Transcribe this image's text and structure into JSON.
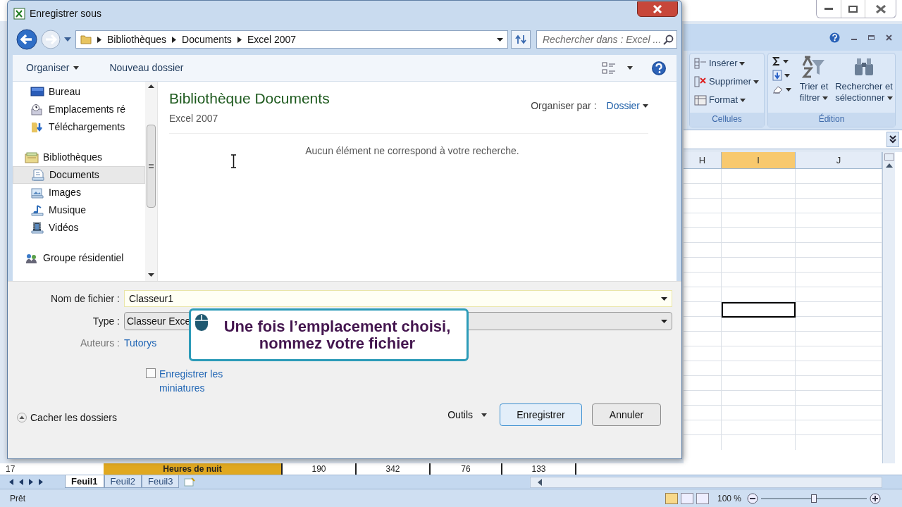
{
  "dialog": {
    "title": "Enregistrer sous",
    "breadcrumb": [
      "Bibliothèques",
      "Documents",
      "Excel 2007"
    ],
    "search": {
      "placeholder": "Rechercher dans : Excel ..."
    },
    "toolbar": [
      "Organiser",
      "Nouveau dossier"
    ],
    "nav_items": [
      {
        "kind": "item",
        "label": "Bureau",
        "selected": false
      },
      {
        "kind": "item",
        "label": "Emplacements ré",
        "selected": false
      },
      {
        "kind": "item",
        "label": "Téléchargements",
        "selected": false
      },
      {
        "kind": "group",
        "label": "Bibliothèques",
        "selected": false
      },
      {
        "kind": "item",
        "label": "Documents",
        "selected": true
      },
      {
        "kind": "item",
        "label": "Images",
        "selected": false
      },
      {
        "kind": "item",
        "label": "Musique",
        "selected": false
      },
      {
        "kind": "item",
        "label": "Vidéos",
        "selected": false
      },
      {
        "kind": "group",
        "label": "Groupe résidentiel",
        "selected": false
      }
    ],
    "library": {
      "title": "Bibliothèque Documents",
      "subtitle": "Excel 2007",
      "arrange_label": "Organiser par :",
      "arrange_value": "Dossier"
    },
    "empty_message": "Aucun élément ne correspond à votre recherche.",
    "fields": {
      "filename_label": "Nom de fichier :",
      "filename": "Classeur1",
      "type_label": "Type :",
      "type": "Classeur Exce",
      "authors_label": "Auteurs :",
      "authors": "Tutorys"
    },
    "thumbnail_checkbox": {
      "label": "Enregistrer les miniatures",
      "checked": false
    },
    "hide_folders": "Cacher les dossiers",
    "tools": "Outils",
    "buttons": [
      "Enregistrer",
      "Annuler"
    ]
  },
  "callout": {
    "text": "Une fois l’emplacement choisi, nommez votre fichier"
  },
  "excel": {
    "ribbon_groups": [
      {
        "label": "Cellules",
        "items": [
          "Insérer",
          "Supprimer",
          "Format"
        ]
      },
      {
        "label": "Édition",
        "items": [
          "Trier et filtrer",
          "Rechercher et sélectionner"
        ]
      }
    ],
    "columns": [
      {
        "label": "H",
        "selected": false
      },
      {
        "label": "I",
        "selected": true
      },
      {
        "label": "J",
        "selected": false
      }
    ],
    "row": {
      "number": "17",
      "cells": [
        "Heures de nuit",
        "190",
        "342",
        "76",
        "133"
      ]
    },
    "sheet_tabs": [
      {
        "label": "Feuil1",
        "selected": true
      },
      {
        "label": "Feuil2",
        "selected": false
      },
      {
        "label": "Feuil3",
        "selected": false
      }
    ],
    "status": "Prêt",
    "zoom": "100 %",
    "zoom_slider": {
      "level": 0.5
    }
  }
}
